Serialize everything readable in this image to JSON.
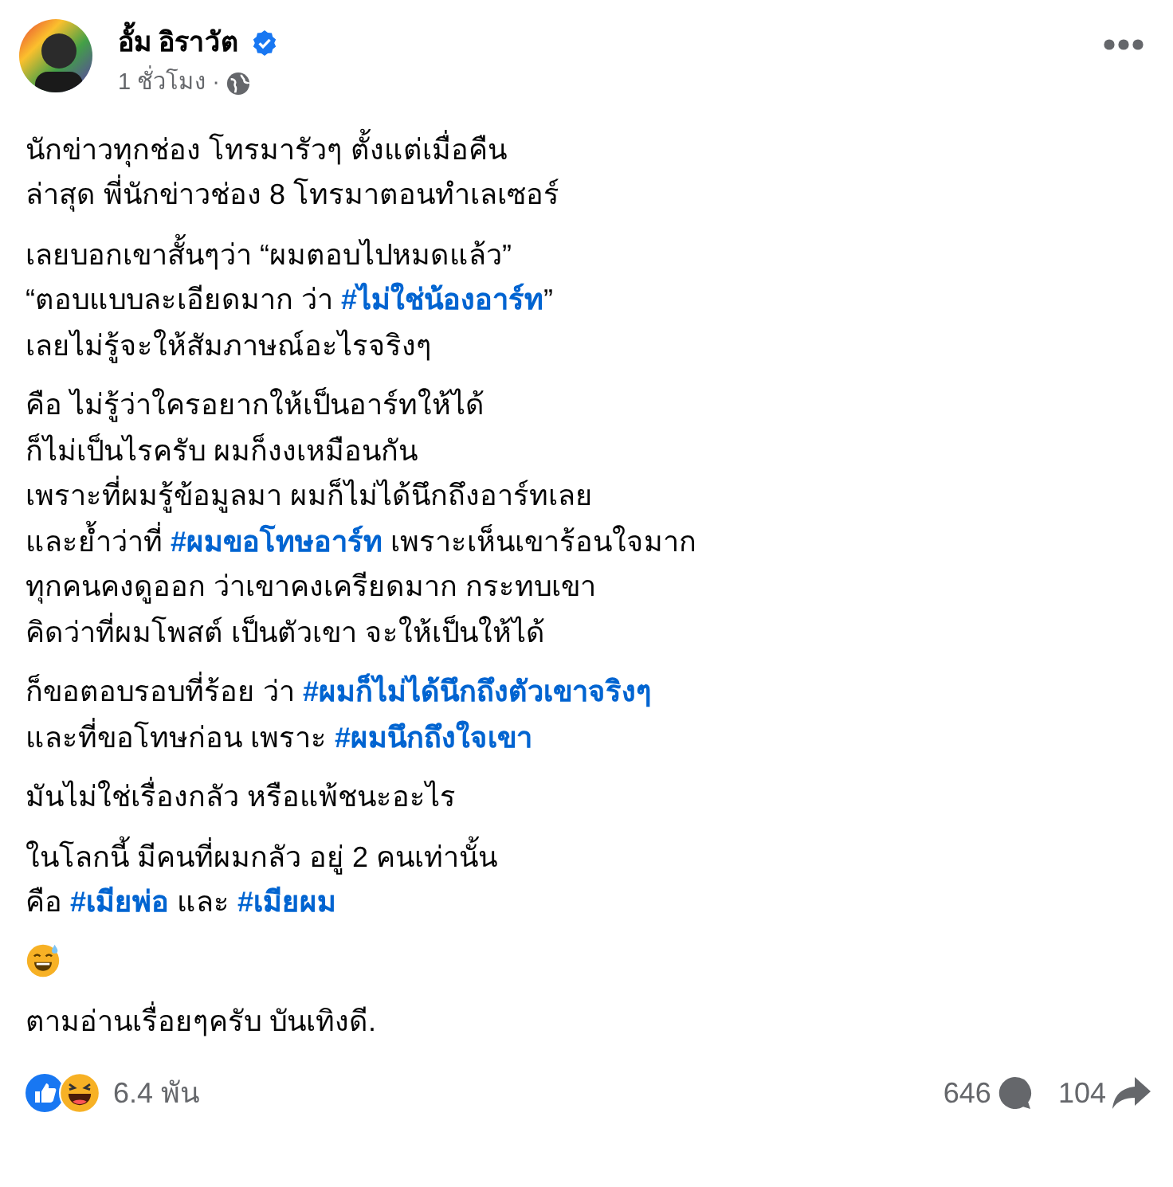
{
  "post": {
    "author": "อั้ม อิราวัต",
    "verified": true,
    "time": "1 ชั่วโมง",
    "time_separator": "·",
    "paragraphs": [
      {
        "kind": "text",
        "lines": [
          [
            {
              "kind": "plain",
              "text": "นักข่าวทุกช่อง โทรมารัวๆ ตั้งแต่เมื่อคืน"
            }
          ],
          [
            {
              "kind": "plain",
              "text": "ล่าสุด พี่นักข่าวช่อง 8 โทรมาตอนทำเลเซอร์"
            }
          ]
        ]
      },
      {
        "kind": "text",
        "lines": [
          [
            {
              "kind": "plain",
              "text": "เลยบอกเขาสั้นๆว่า “ผมตอบไปหมดแล้ว”"
            }
          ],
          [
            {
              "kind": "plain",
              "text": "“ตอบแบบละเอียดมาก ว่า "
            },
            {
              "kind": "hashtag",
              "text": "#ไม่ใช่น้องอาร์ท"
            },
            {
              "kind": "plain",
              "text": "”"
            }
          ],
          [
            {
              "kind": "plain",
              "text": "เลยไม่รู้จะให้สัมภาษณ์อะไรจริงๆ"
            }
          ]
        ]
      },
      {
        "kind": "text",
        "lines": [
          [
            {
              "kind": "plain",
              "text": "คือ ไม่รู้ว่าใครอยากให้เป็นอาร์ทให้ได้"
            }
          ],
          [
            {
              "kind": "plain",
              "text": "ก็ไม่เป็นไรครับ ผมก็งงเหมือนกัน"
            }
          ],
          [
            {
              "kind": "plain",
              "text": "เพราะที่ผมรู้ข้อมูลมา ผมก็ไม่ได้นึกถึงอาร์ทเลย"
            }
          ],
          [
            {
              "kind": "plain",
              "text": "และย้ำว่าที่ "
            },
            {
              "kind": "hashtag",
              "text": "#ผมขอโทษอาร์ท"
            },
            {
              "kind": "plain",
              "text": " เพราะเห็นเขาร้อนใจมาก"
            }
          ],
          [
            {
              "kind": "plain",
              "text": "ทุกคนคงดูออก ว่าเขาคงเครียดมาก กระทบเขา"
            }
          ],
          [
            {
              "kind": "plain",
              "text": "คิดว่าที่ผมโพสต์ เป็นตัวเขา จะให้เป็นให้ได้"
            }
          ]
        ]
      },
      {
        "kind": "text",
        "lines": [
          [
            {
              "kind": "plain",
              "text": "ก็ขอตอบรอบที่ร้อย ว่า "
            },
            {
              "kind": "hashtag",
              "text": "#ผมก็ไม่ได้นึกถึงตัวเขาจริงๆ"
            }
          ],
          [
            {
              "kind": "plain",
              "text": "และที่ขอโทษก่อน เพราะ "
            },
            {
              "kind": "hashtag",
              "text": "#ผมนึกถึงใจเขา"
            }
          ]
        ]
      },
      {
        "kind": "text",
        "lines": [
          [
            {
              "kind": "plain",
              "text": "มันไม่ใช่เรื่องกลัว หรือแพ้ชนะอะไร"
            }
          ]
        ]
      },
      {
        "kind": "text",
        "lines": [
          [
            {
              "kind": "plain",
              "text": "ในโลกนี้ มีคนที่ผมกลัว อยู่ 2 คนเท่านั้น"
            }
          ],
          [
            {
              "kind": "plain",
              "text": "คือ "
            },
            {
              "kind": "hashtag",
              "text": "#เมียพ่อ"
            },
            {
              "kind": "plain",
              "text": " และ "
            },
            {
              "kind": "hashtag",
              "text": "#เมียผม"
            }
          ]
        ]
      },
      {
        "kind": "emoji"
      },
      {
        "kind": "text",
        "lines": [
          [
            {
              "kind": "plain",
              "text": "ตามอ่านเรื่อยๆครับ บันเทิงดี."
            }
          ]
        ]
      }
    ]
  },
  "footer": {
    "reactions": "6.4 พัน",
    "comments": "646",
    "shares": "104"
  }
}
